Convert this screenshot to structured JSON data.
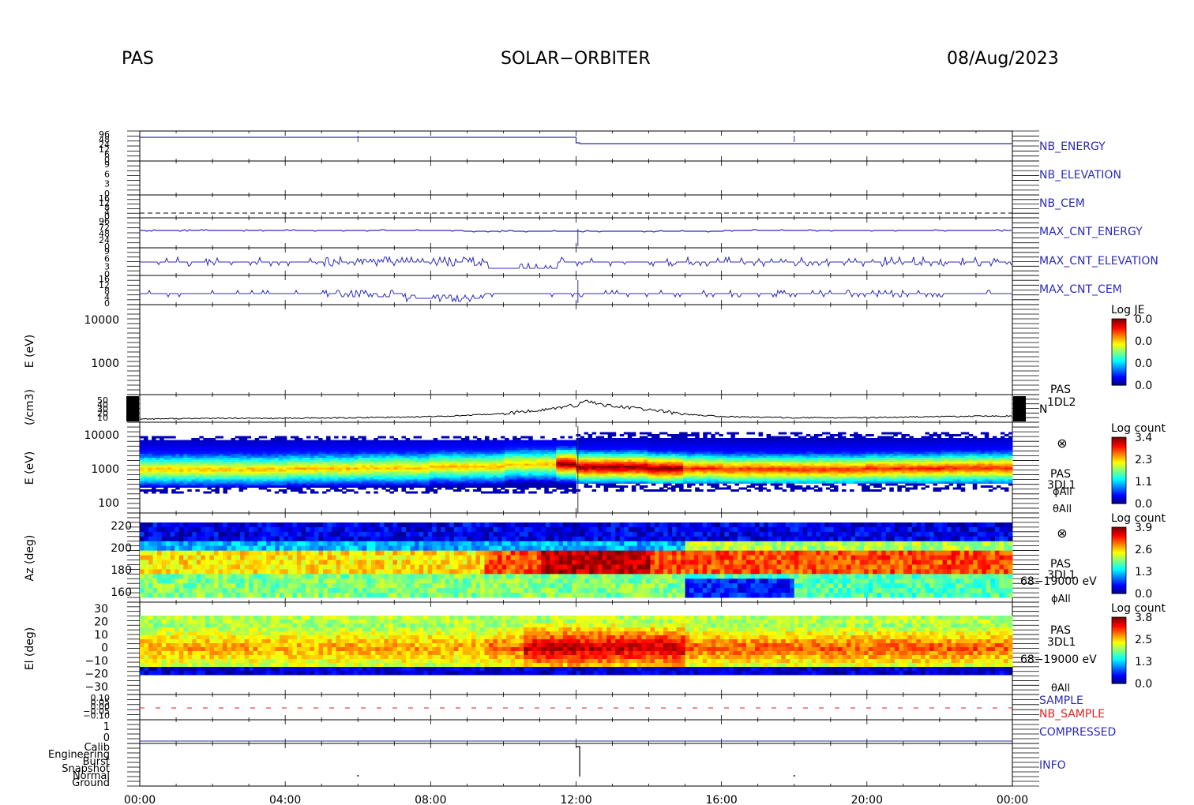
{
  "header": {
    "instrument": "PAS",
    "mission": "SOLAR−ORBITER",
    "date": "08/Aug/2023"
  },
  "time_axis": {
    "labels": [
      "00:00",
      "04:00",
      "08:00",
      "12:00",
      "16:00",
      "20:00",
      "00:00"
    ],
    "hours": [
      0,
      4,
      8,
      12,
      16,
      20,
      24
    ]
  },
  "chart_data": [
    {
      "type": "line",
      "name": "NB_ENERGY",
      "tick_labels": [
        "96",
        "48",
        "24",
        "12",
        "6",
        "0"
      ],
      "color": "#2b2bb8",
      "series": [
        {
          "x": [
            0,
            6,
            12.0,
            12.1,
            18,
            24
          ],
          "y": [
            96,
            96,
            96,
            0,
            0,
            0
          ]
        }
      ],
      "spikes_hours": [
        6.0,
        18.0
      ]
    },
    {
      "type": "line",
      "name": "NB_ELEVATION",
      "tick_labels": [
        "9",
        "6",
        "3",
        "0"
      ],
      "color": "#2b2bb8",
      "series": []
    },
    {
      "type": "line",
      "name": "NB_CEM",
      "tick_labels": [
        "16",
        "12",
        "8",
        "4",
        "0"
      ],
      "color": "#2b2bb8",
      "series": []
    },
    {
      "type": "line",
      "name": "MAX_CNT_ENERGY",
      "tick_labels": [
        "96",
        "72",
        "48",
        "24",
        "0"
      ],
      "color": "#2b2bb8",
      "series": []
    },
    {
      "type": "line",
      "name": "MAX_CNT_ELEVATION",
      "tick_labels": [
        "9",
        "6",
        "3",
        "0"
      ],
      "color": "#2b2bb8",
      "series": []
    },
    {
      "type": "line",
      "name": "MAX_CNT_CEM",
      "tick_labels": [
        "16",
        "12",
        "8",
        "4",
        "0"
      ],
      "color": "#2b2bb8",
      "series": []
    },
    {
      "type": "heatmap",
      "ylabel": "E (eV)",
      "y_tick_labels": [
        "10000",
        "1000"
      ],
      "colorbar": {
        "title": "Log JE",
        "ticks": [
          "0.0",
          "0.0",
          "0.0",
          "0.0"
        ]
      },
      "values": []
    },
    {
      "type": "line",
      "ylabel": "(/cm3)",
      "y_tick_labels": [
        "50",
        "40",
        "30",
        "20",
        "10"
      ],
      "right_labels": [
        "PAS",
        "1DL2",
        "N"
      ],
      "series": [
        {
          "x": [
            0,
            2,
            4,
            6,
            8,
            9,
            10,
            11,
            11.5,
            12,
            12.3,
            12.6,
            13,
            14,
            15,
            16,
            18,
            20,
            22,
            24
          ],
          "y": [
            11,
            12,
            12,
            13,
            15,
            17,
            20,
            26,
            30,
            34,
            42,
            37,
            33,
            27,
            19,
            15,
            13,
            13,
            15,
            16
          ]
        }
      ]
    },
    {
      "type": "heatmap",
      "ylabel": "E (eV)",
      "y_tick_labels": [
        "10000",
        "1000",
        "100"
      ],
      "right_labels": [
        "⊗",
        "PAS",
        "3DL1",
        "ϕAll",
        "θAll"
      ],
      "colorbar": {
        "title": "Log count",
        "ticks": [
          "3.4",
          "2.3",
          "1.1",
          "0.0"
        ]
      },
      "peak_energy_eV": [
        900,
        900,
        950,
        1000,
        1100,
        1300,
        1050,
        950,
        900,
        900,
        950,
        1000
      ]
    },
    {
      "type": "heatmap",
      "ylabel": "Az (deg)",
      "y_tick_labels": [
        "220",
        "200",
        "180",
        "160"
      ],
      "right_labels": [
        "⊗",
        "PAS",
        "3DL1",
        "68−19000 eV",
        "ϕAll"
      ],
      "colorbar": {
        "title": "Log count",
        "ticks": [
          "3.9",
          "2.6",
          "1.3",
          "0.0"
        ]
      }
    },
    {
      "type": "heatmap",
      "ylabel": "El (deg)",
      "y_tick_labels": [
        "30",
        "20",
        "10",
        "0",
        "−10",
        "−20",
        "−30"
      ],
      "right_labels": [
        "PAS",
        "3DL1",
        "68−19000 eV",
        "θAll"
      ],
      "colorbar": {
        "title": "Log count",
        "ticks": [
          "3.8",
          "2.5",
          "1.3",
          "0.0"
        ]
      }
    },
    {
      "type": "line",
      "y_tick_labels": [
        "0.10",
        "0.05",
        "0.00",
        "−0.05",
        "−0.10"
      ],
      "right_labels": [
        "SAMPLE",
        "NB_SAMPLE"
      ],
      "colors": [
        "#2b2bb8",
        "#dd2222"
      ],
      "series": [
        {
          "name": "NB_SAMPLE",
          "x": [
            0,
            24
          ],
          "y": [
            0,
            0
          ]
        }
      ]
    },
    {
      "type": "line",
      "y_tick_labels": [
        "1",
        "0"
      ],
      "right_labels": [
        "COMPRESSED"
      ],
      "color": "#2b2bb8",
      "series": [
        {
          "name": "COMPRESSED",
          "x": [
            0,
            24
          ],
          "y": [
            0,
            0
          ]
        }
      ]
    },
    {
      "type": "line",
      "y_tick_labels": [
        "Calib",
        "Engineering",
        "Burst",
        "Snapshot",
        "Normal",
        "Ground"
      ],
      "right_labels": [
        "INFO"
      ],
      "series": [
        {
          "x": [
            12.0,
            12.1,
            12.1
          ],
          "y": [
            5,
            5,
            1
          ]
        }
      ]
    }
  ]
}
